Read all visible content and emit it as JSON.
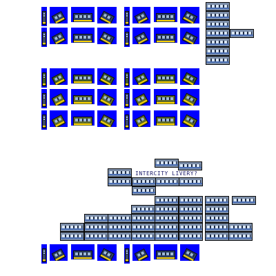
{
  "sprite_sheet": {
    "caption": "INTERCITY LIVERY?",
    "background_color": "#ffffff",
    "tile_color": "#0000ff",
    "train_body_color": "#2b3f66",
    "accent_yellow": "#ffd400"
  }
}
